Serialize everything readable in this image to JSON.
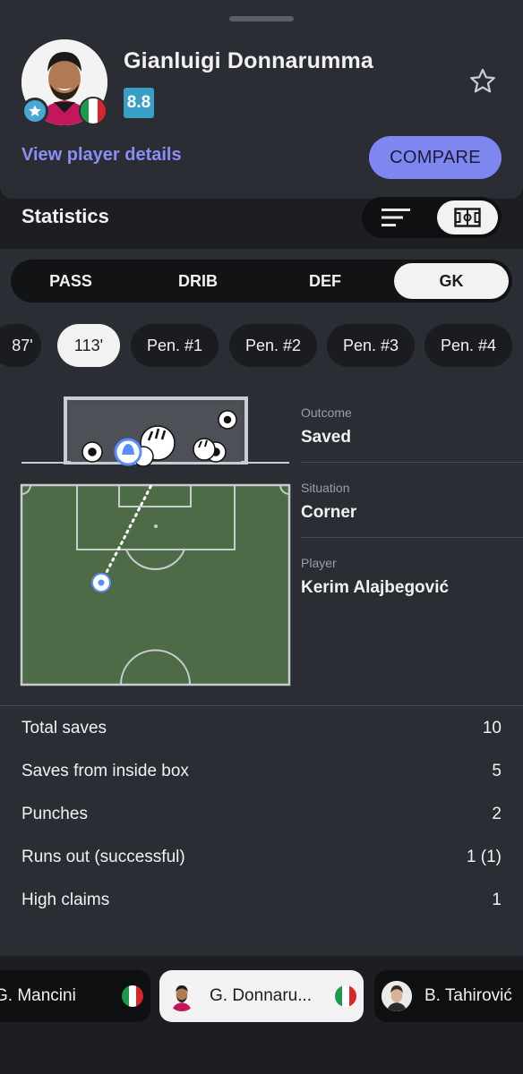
{
  "player": {
    "name": "Gianluigi Donnarumma",
    "rating": "8.8",
    "view_details_label": "View player details",
    "compare_label": "COMPARE"
  },
  "statistics": {
    "title": "Statistics"
  },
  "tabs": [
    {
      "label": "PASS",
      "active": false
    },
    {
      "label": "DRIB",
      "active": false
    },
    {
      "label": "DEF",
      "active": false
    },
    {
      "label": "GK",
      "active": true
    }
  ],
  "events": [
    {
      "label": "87'",
      "active": false
    },
    {
      "label": "113'",
      "active": true
    },
    {
      "label": "Pen. #1",
      "active": false
    },
    {
      "label": "Pen. #2",
      "active": false
    },
    {
      "label": "Pen. #3",
      "active": false
    },
    {
      "label": "Pen. #4",
      "active": false
    }
  ],
  "event_info": [
    {
      "label": "Outcome",
      "value": "Saved"
    },
    {
      "label": "Situation",
      "value": "Corner"
    },
    {
      "label": "Player",
      "value": "Kerim Alajbegović"
    }
  ],
  "gk_stats": [
    {
      "label": "Total saves",
      "value": "10"
    },
    {
      "label": "Saves from inside box",
      "value": "5"
    },
    {
      "label": "Punches",
      "value": "2"
    },
    {
      "label": "Runs out (successful)",
      "value": "1 (1)"
    },
    {
      "label": "High claims",
      "value": "1"
    }
  ],
  "player_switcher": [
    {
      "name": "G. Mancini",
      "flag": "italy",
      "active": false
    },
    {
      "name": "G. Donnaru...",
      "flag": "italy",
      "active": true
    },
    {
      "name": "B. Tahirović",
      "flag": "",
      "active": false
    }
  ],
  "colors": {
    "accent": "#7f86f0",
    "rating_badge": "#3a9fc6",
    "pitch": "#4e6b48",
    "panel": "#2a2d33",
    "background": "#1c1e22"
  }
}
